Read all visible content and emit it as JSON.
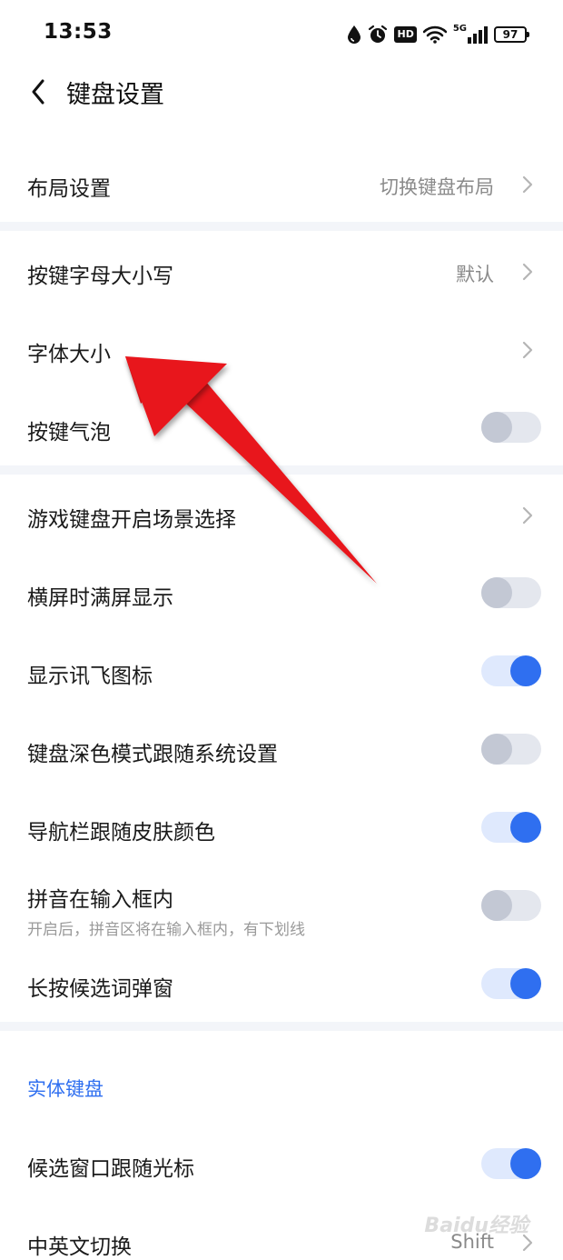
{
  "status_bar": {
    "time": "13:53",
    "hd": "HD",
    "network": "5G",
    "battery": "97"
  },
  "header": {
    "title": "键盘设置"
  },
  "rows": {
    "layout": {
      "label": "布局设置",
      "value": "切换键盘布局"
    },
    "key_case": {
      "label": "按键字母大小写",
      "value": "默认"
    },
    "font_size": {
      "label": "字体大小"
    },
    "key_bubble": {
      "label": "按键气泡",
      "toggle": "off"
    },
    "game_keyboard": {
      "label": "游戏键盘开启场景选择"
    },
    "landscape_full": {
      "label": "横屏时满屏显示",
      "toggle": "off"
    },
    "show_xunfei_icon": {
      "label": "显示讯飞图标",
      "toggle": "on"
    },
    "dark_mode_follow": {
      "label": "键盘深色模式跟随系统设置",
      "toggle": "off"
    },
    "navbar_follow_skin": {
      "label": "导航栏跟随皮肤颜色",
      "toggle": "on"
    },
    "pinyin_in_input": {
      "label": "拼音在输入框内",
      "sub": "开启后，拼音区将在输入框内，有下划线",
      "toggle": "off"
    },
    "long_press_popup": {
      "label": "长按候选词弹窗",
      "toggle": "on"
    }
  },
  "section_physical": {
    "title": "实体键盘",
    "candidate_follow_cursor": {
      "label": "候选窗口跟随光标",
      "toggle": "on"
    },
    "cn_en_switch": {
      "label": "中英文切换",
      "value": "Shift"
    }
  },
  "watermark": "Baidu经验",
  "colors": {
    "accent": "#2f6ff0",
    "toggle_on_track": "#dfe9fd",
    "toggle_off_track": "#e4e7ee",
    "divider": "#f3f5f9",
    "annotation_arrow": "#e8141a"
  }
}
